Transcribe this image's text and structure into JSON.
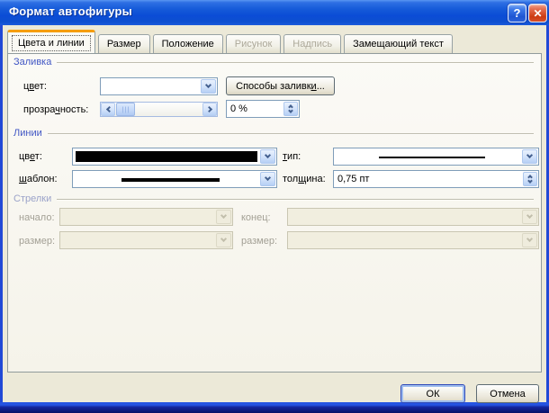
{
  "window": {
    "title": "Формат автофигуры",
    "help_glyph": "?",
    "close_glyph": "✕"
  },
  "tabs": [
    {
      "label": "Цвета и линии",
      "state": "active"
    },
    {
      "label": "Размер",
      "state": "normal"
    },
    {
      "label": "Положение",
      "state": "normal"
    },
    {
      "label": "Рисунок",
      "state": "disabled"
    },
    {
      "label": "Надпись",
      "state": "disabled"
    },
    {
      "label": "Замещающий текст",
      "state": "normal"
    }
  ],
  "fill": {
    "section_label": "Заливка",
    "color_label": {
      "pre": "ц",
      "key": "в",
      "post": "ет:"
    },
    "color_value": "",
    "fill_effects_button": {
      "pre": "Способы заливк",
      "key": "и",
      "post": "..."
    },
    "transparency_label": {
      "pre": "прозра",
      "key": "ч",
      "post": "ность:"
    },
    "transparency_value": "0 %"
  },
  "line": {
    "section_label": "Линии",
    "color_label": {
      "pre": "цв",
      "key": "е",
      "post": "т:"
    },
    "type_label": {
      "pre": "",
      "key": "т",
      "post": "ип:"
    },
    "dash_label": {
      "pre": "",
      "key": "ш",
      "post": "аблон:"
    },
    "weight_label": {
      "pre": "тол",
      "key": "щ",
      "post": "ина:"
    },
    "weight_value": "0,75 пт"
  },
  "arrows": {
    "section_label": "Стрелки",
    "begin_label": "начало:",
    "end_label": "конец:",
    "begin_size_label": "размер:",
    "end_size_label": "размер:"
  },
  "footer": {
    "ok_label": "ОК",
    "cancel_label": "Отмена"
  },
  "colors": {
    "titlebar_blue": "#0E50D2",
    "dialog_bg": "#ECE9D8",
    "tab_accent_orange": "#F59D00",
    "group_label_blue": "#4156C4",
    "disabled_text": "#ACA899",
    "close_red": "#D8502E",
    "line_color_swatch": "#000000"
  }
}
